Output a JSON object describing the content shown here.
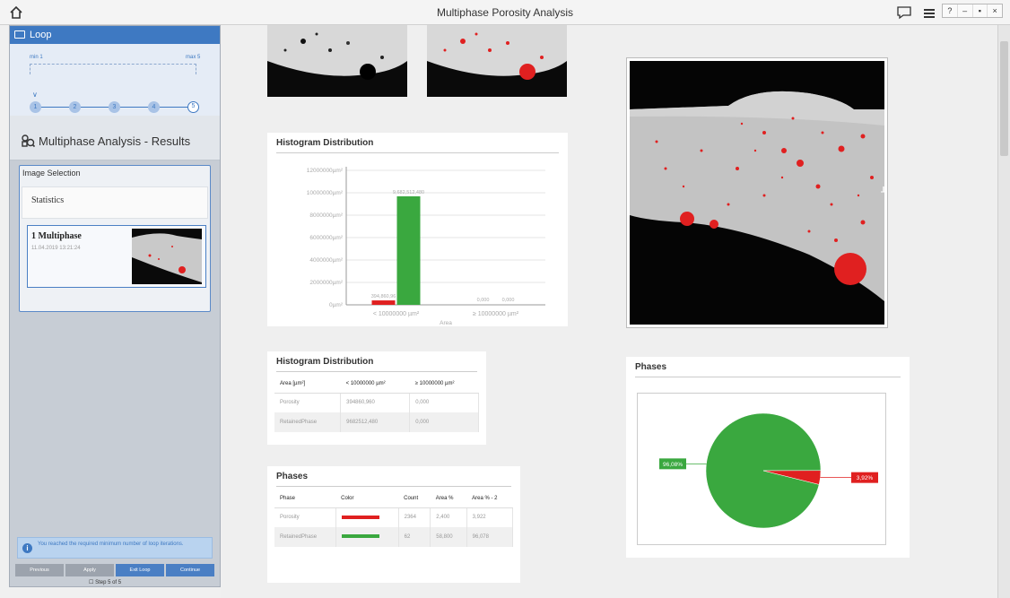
{
  "window": {
    "title": "Multiphase Porosity Analysis",
    "buttons": [
      "?",
      "–",
      "▪",
      "×"
    ]
  },
  "loop": {
    "header": "Loop",
    "min_label": "min 1",
    "max_label": "max 5",
    "steps": [
      "1",
      "2",
      "3",
      "4",
      "5"
    ],
    "active_step": 5
  },
  "results": {
    "title": "Multiphase Analysis - Results",
    "selection_title": "Image Selection",
    "statistics_label": "Statistics",
    "item_title": "1 Multiphase",
    "item_date": "11.04.2019 13:21:24"
  },
  "notice": "You reached the required minimum number of loop iterations.",
  "actions": {
    "previous": "Previous",
    "apply": "Apply",
    "exit_loop": "Exit Loop",
    "continue": "Continue"
  },
  "step_footer": "Step 5 of 5",
  "histogram_chart": {
    "title": "Histogram Distribution"
  },
  "histogram_table": {
    "title": "Histogram Distribution",
    "headers": [
      "Area [µm²]",
      "< 10000000 µm²",
      "≥ 10000000 µm²"
    ],
    "rows": [
      [
        "Porosity",
        "394860,960",
        "0,000"
      ],
      [
        "RetainedPhase",
        "9682512,480",
        "0,000"
      ]
    ]
  },
  "phases_table": {
    "title": "Phases",
    "headers": [
      "Phase",
      "Color",
      "Count",
      "Area %",
      "Area % - 2"
    ],
    "rows": [
      {
        "phase": "Porosity",
        "color": "#e02020",
        "count": "2364",
        "area": "2,400",
        "area2": "3,922"
      },
      {
        "phase": "RetainedPhase",
        "color": "#3aa83f",
        "count": "62",
        "area": "58,800",
        "area2": "96,078"
      }
    ]
  },
  "phases_chart": {
    "title": "Phases"
  },
  "chart_data": [
    {
      "type": "bar",
      "title": "Histogram Distribution",
      "xlabel": "Area",
      "ylabel": "",
      "categories": [
        "< 10000000 µm²",
        "≥ 10000000 µm²"
      ],
      "yticks": [
        "0µm²",
        "2000000µm²",
        "4000000µm²",
        "6000000µm²",
        "8000000µm²",
        "10000000µm²",
        "12000000µm²"
      ],
      "ylim": [
        0,
        12000000
      ],
      "series": [
        {
          "name": "Porosity",
          "color": "#e02020",
          "values": [
            394860.96,
            0
          ],
          "labels": [
            "394,860,96",
            "0,000"
          ]
        },
        {
          "name": "RetainedPhase",
          "color": "#3aa83f",
          "values": [
            9682512.48,
            0
          ],
          "labels": [
            "9,682,512,480",
            "0,000"
          ]
        }
      ]
    },
    {
      "type": "pie",
      "title": "Phases",
      "slices": [
        {
          "name": "RetainedPhase",
          "value": 96.08,
          "label": "96,08%",
          "color": "#3aa83f"
        },
        {
          "name": "Porosity",
          "value": 3.92,
          "label": "3,92%",
          "color": "#e02020"
        }
      ]
    }
  ]
}
